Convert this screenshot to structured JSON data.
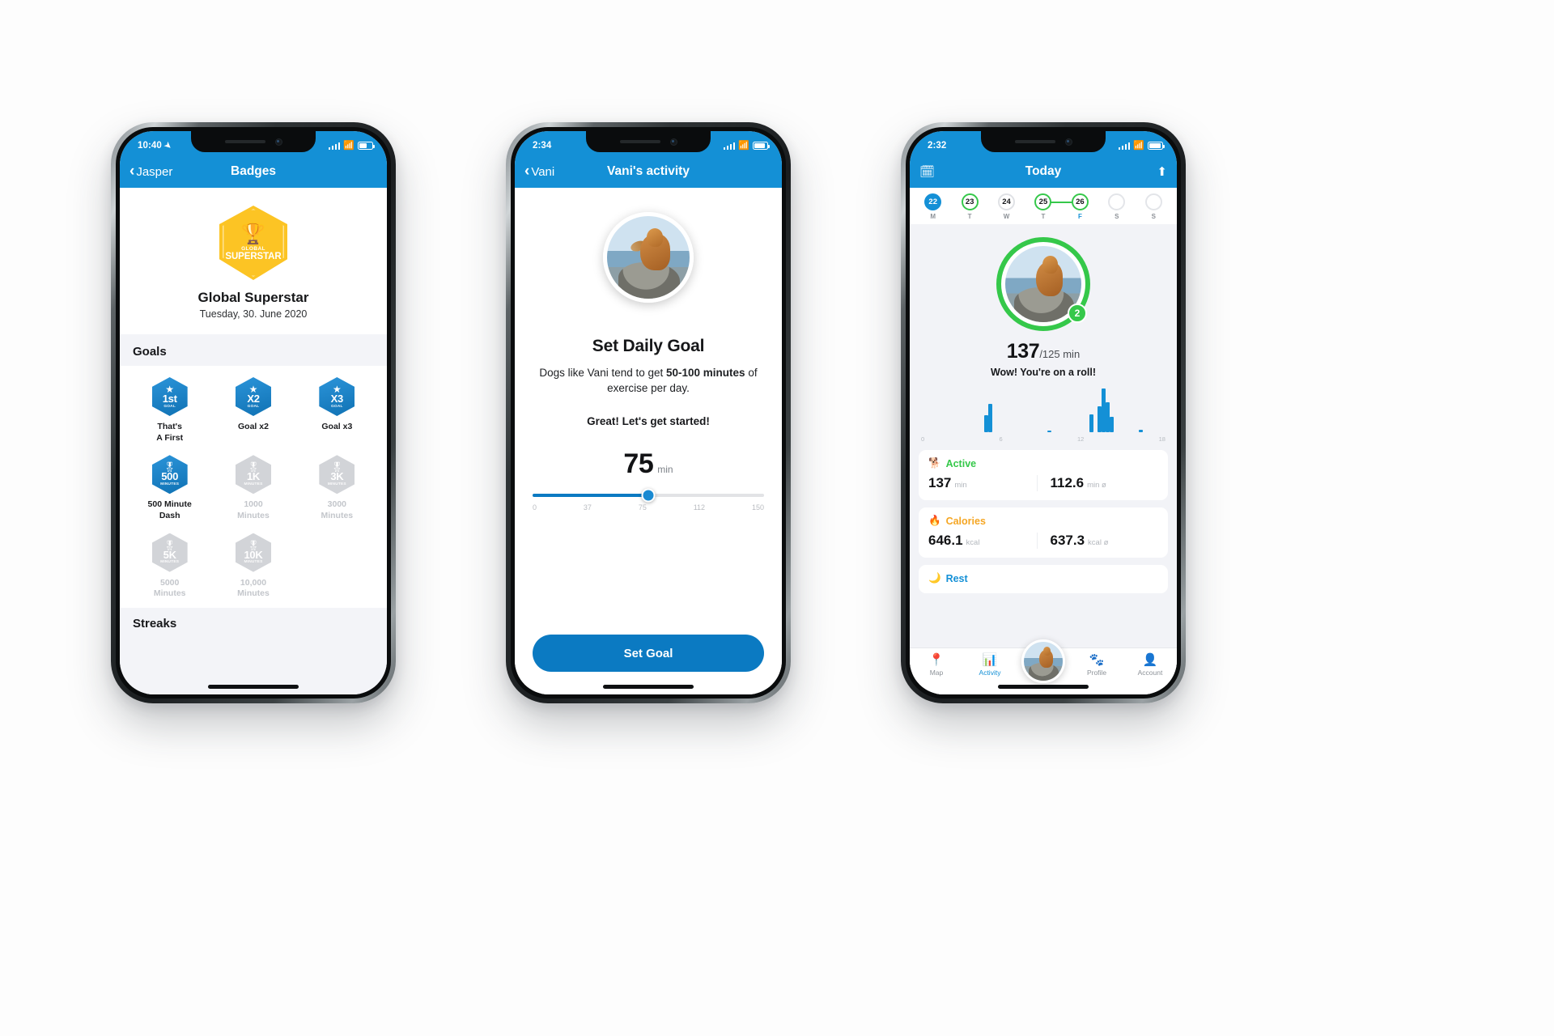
{
  "phone1": {
    "status": {
      "time": "10:40",
      "location_icon": "location-arrow-icon",
      "battery": "battery-icon"
    },
    "nav": {
      "back_label": "Jasper",
      "title": "Badges"
    },
    "hero": {
      "badge_line1": "GLOBAL",
      "badge_line2": "SUPERSTAR",
      "trophy_icon": "trophy-icon",
      "title": "Global Superstar",
      "date": "Tuesday, 30. June 2020"
    },
    "goals_section_title": "Goals",
    "streaks_section_title": "Streaks",
    "goals": [
      {
        "num": "1st",
        "sub": "GOAL",
        "icon": "star-icon",
        "label": "That's\nA First",
        "unlocked": true
      },
      {
        "num": "X2",
        "sub": "GOAL",
        "icon": "star-icon",
        "label": "Goal x2",
        "unlocked": true
      },
      {
        "num": "X3",
        "sub": "GOAL",
        "icon": "star-icon",
        "label": "Goal x3",
        "unlocked": true
      },
      {
        "num": "500",
        "sub": "MINUTES",
        "icon": "medal-icon",
        "label": "500 Minute\nDash",
        "unlocked": true
      },
      {
        "num": "1K",
        "sub": "MINUTES",
        "icon": "medal-icon",
        "label": "1000\nMinutes",
        "unlocked": false
      },
      {
        "num": "3K",
        "sub": "MINUTES",
        "icon": "medal-icon",
        "label": "3000\nMinutes",
        "unlocked": false
      },
      {
        "num": "5K",
        "sub": "MINUTES",
        "icon": "medal-icon",
        "label": "5000\nMinutes",
        "unlocked": false
      },
      {
        "num": "10K",
        "sub": "MINUTES",
        "icon": "medal-icon",
        "label": "10,000\nMinutes",
        "unlocked": false
      }
    ]
  },
  "phone2": {
    "status": {
      "time": "2:34"
    },
    "nav": {
      "back_label": "Vani",
      "title": "Vani's activity"
    },
    "avatar_icon": "dog-photo-avatar",
    "title": "Set Daily Goal",
    "desc_before": "Dogs like Vani tend to get ",
    "desc_bold": "50-100 minutes",
    "desc_after": " of exercise per day.",
    "encouragement": "Great! Let's get started!",
    "value": "75",
    "value_unit": "min",
    "slider": {
      "min": 0,
      "max": 150,
      "current": 75,
      "ticks": [
        "0",
        "37",
        "75",
        "112",
        "150"
      ]
    },
    "submit_label": "Set Goal"
  },
  "phone3": {
    "status": {
      "time": "2:32"
    },
    "nav": {
      "calendar_icon": "calendar-icon",
      "title": "Today",
      "share_icon": "share-icon"
    },
    "days": [
      {
        "num": "22",
        "letter": "M",
        "state": "filled"
      },
      {
        "num": "23",
        "letter": "T",
        "state": "ring"
      },
      {
        "num": "24",
        "letter": "W",
        "state": "plain"
      },
      {
        "num": "25",
        "letter": "T",
        "state": "ring"
      },
      {
        "num": "26",
        "letter": "F",
        "state": "ring",
        "today": true
      },
      {
        "num": "",
        "letter": "S",
        "state": "empty"
      },
      {
        "num": "",
        "letter": "S",
        "state": "empty"
      }
    ],
    "ring": {
      "badge_count": "2",
      "value": "137",
      "goal": "/125 min",
      "message": "Wow! You're on a roll!"
    },
    "chart_data": {
      "type": "bar",
      "title": "",
      "xlabel": "",
      "ylabel": "",
      "x": [
        6.2,
        6.6,
        12.4,
        16.5,
        17.3,
        17.7,
        18.1,
        18.5,
        21.4
      ],
      "values": [
        22,
        38,
        2,
        24,
        34,
        58,
        40,
        20,
        3
      ],
      "ylim": [
        0,
        60
      ],
      "axis_ticks": [
        "0",
        "6",
        "12",
        "18"
      ],
      "grid": false,
      "bar_color": "#1490d6"
    },
    "stats": [
      {
        "icon": "dog-icon",
        "label": "Active",
        "color": "#35c84a",
        "primary_value": "137",
        "primary_unit": "min",
        "secondary_value": "112.6",
        "secondary_unit": "min ø"
      },
      {
        "icon": "flame-icon",
        "label": "Calories",
        "color": "#f5a623",
        "primary_value": "646.1",
        "primary_unit": "kcal",
        "secondary_value": "637.3",
        "secondary_unit": "kcal ø"
      },
      {
        "icon": "moon-icon",
        "label": "Rest",
        "color": "#1490d6",
        "primary_value": "",
        "primary_unit": "",
        "secondary_value": "",
        "secondary_unit": ""
      }
    ],
    "tabs": [
      {
        "icon": "map-pin-icon",
        "label": "Map",
        "active": false
      },
      {
        "icon": "activity-icon",
        "label": "Activity",
        "active": true
      },
      {
        "icon": "dog-avatar-icon",
        "label": "",
        "active": false
      },
      {
        "icon": "paw-icon",
        "label": "Profile",
        "active": false
      },
      {
        "icon": "account-icon",
        "label": "Account",
        "active": false
      }
    ]
  }
}
